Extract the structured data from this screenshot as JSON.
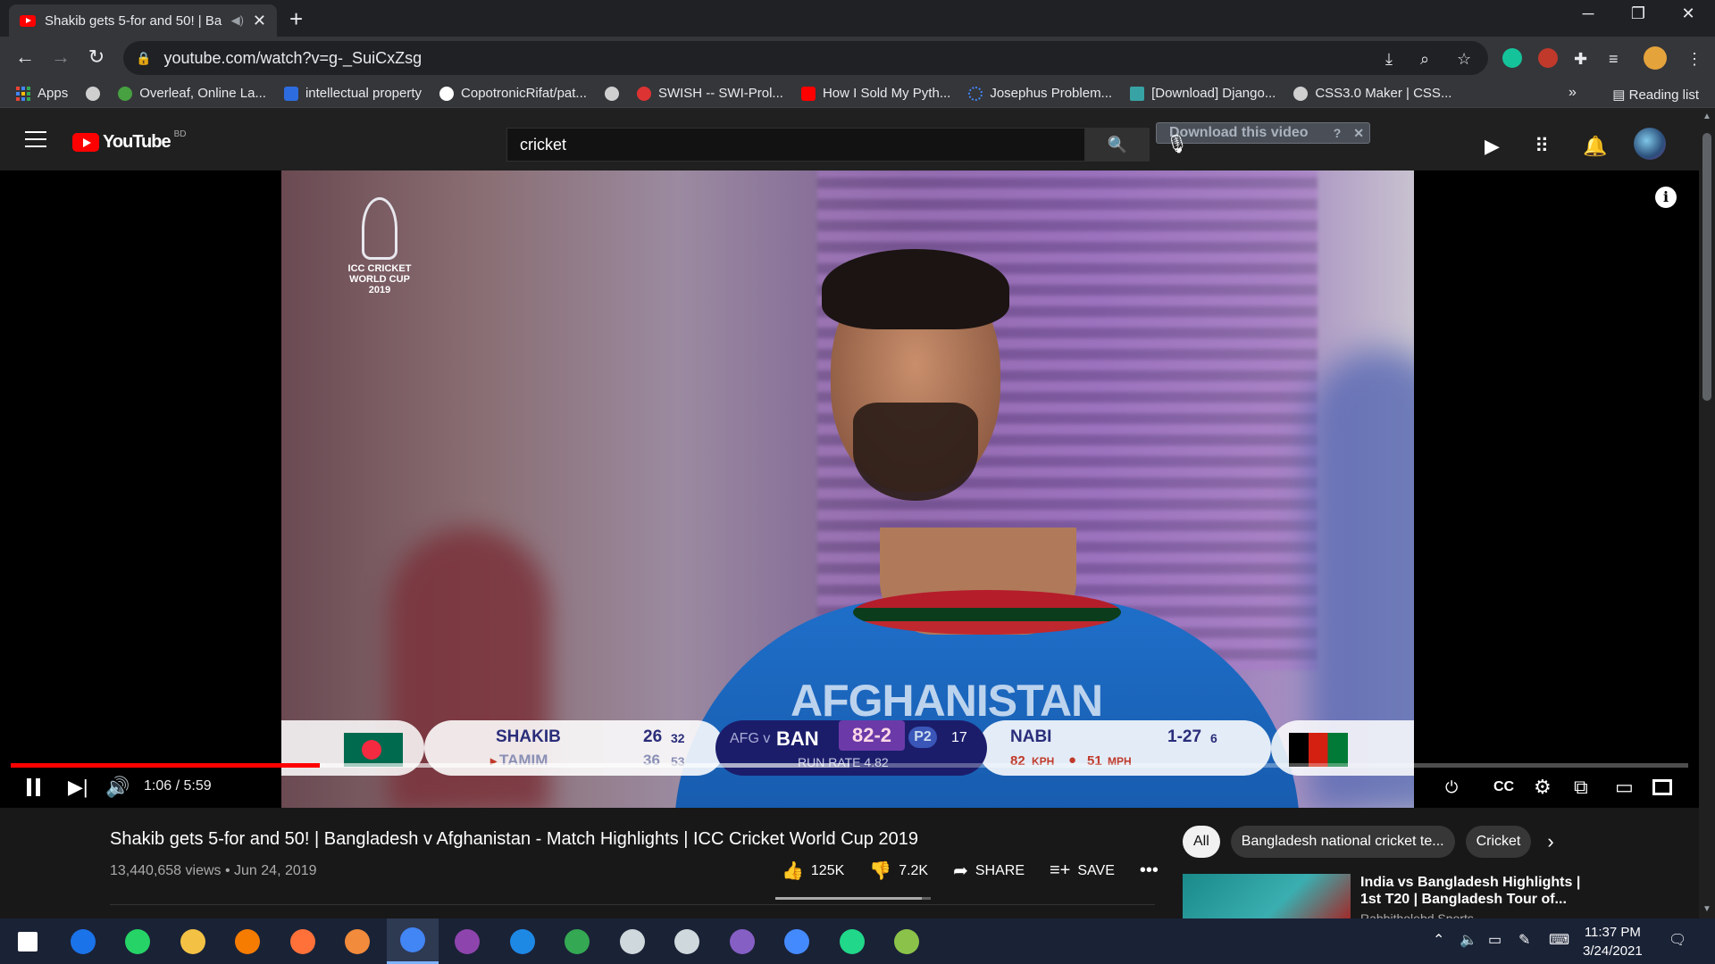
{
  "browser": {
    "tab": {
      "title": "Shakib gets 5-for and 50! | Ba"
    },
    "url": "youtube.com/watch?v=g-_SuiCxZsg",
    "bookmarks": [
      {
        "label": "Apps",
        "color": "#ea4335"
      },
      {
        "label": "",
        "color": "#cfcfcf"
      },
      {
        "label": "Overleaf, Online La...",
        "color": "#47a141"
      },
      {
        "label": "intellectual property",
        "color": "#2d6cdf"
      },
      {
        "label": "CopotronicRifat/pat...",
        "color": "#ffffff"
      },
      {
        "label": "",
        "color": "#cfcfcf"
      },
      {
        "label": "SWISH -- SWI-Prol...",
        "color": "#d33"
      },
      {
        "label": "How I Sold My Pyth...",
        "color": "#ff0000"
      },
      {
        "label": "Josephus Problem...",
        "color": "#4285f4"
      },
      {
        "label": "[Download] Django...",
        "color": "#38a3a5"
      },
      {
        "label": "CSS3.0 Maker | CSS...",
        "color": "#cfcfcf"
      }
    ],
    "bookmarks_more": "»",
    "reading_list": "Reading list"
  },
  "youtube": {
    "logo_text": "YouTube",
    "country": "BD",
    "search_value": "cricket",
    "download_label": "Download this video",
    "download_help": "?"
  },
  "video": {
    "cwc_logo": "ICC CRICKET WORLD CUP 2019",
    "jersey_text": "AFGHANISTAN",
    "scoreboard": {
      "batter1_name": "SHAKIB",
      "batter1_runs": "26",
      "batter1_balls": "32",
      "batter2_name": "TAMIM",
      "batter2_runs": "36",
      "batter2_balls": "53",
      "teams_afg": "AFG v",
      "teams_ban": "BAN",
      "score": "82-2",
      "powerplay": "P2",
      "overs": "17",
      "run_rate": "RUN RATE 4.82",
      "bowler_name": "NABI",
      "bowler_figures": "1-27",
      "bowler_overs": "6",
      "speed_kph": "82",
      "kph_unit": "KPH",
      "speed_mph": "51",
      "mph_unit": "MPH"
    },
    "time": "1:06 / 5:59",
    "played_fraction": 0.184,
    "loaded_fraction": 0.5
  },
  "details": {
    "title": "Shakib gets 5-for and 50! | Bangladesh v Afghanistan - Match Highlights | ICC Cricket World Cup 2019",
    "meta": "13,440,658 views • Jun 24, 2019",
    "likes": "125K",
    "dislikes": "7.2K",
    "share_label": "SHARE",
    "save_label": "SAVE",
    "like_ratio": 0.94
  },
  "chips": [
    "All",
    "Bangladesh national cricket te...",
    "Cricket"
  ],
  "recommendation": {
    "title": "India vs Bangladesh Highlights | 1st T20 | Bangladesh Tour of...",
    "channel": "Rabbitholebd Sports"
  },
  "taskbar": {
    "time": "11:37 PM",
    "date": "3/24/2021",
    "apps": [
      {
        "name": "start",
        "color": "#ffffff"
      },
      {
        "name": "anydesk",
        "color": "#1a73e8"
      },
      {
        "name": "whatsapp",
        "color": "#25d366"
      },
      {
        "name": "explorer",
        "color": "#f3c245"
      },
      {
        "name": "avast",
        "color": "#f57c00"
      },
      {
        "name": "firefox",
        "color": "#ff7139"
      },
      {
        "name": "sublime",
        "color": "#f28b3b"
      },
      {
        "name": "chrome",
        "color": "#4285f4"
      },
      {
        "name": "github",
        "color": "#8e44ad"
      },
      {
        "name": "vscode",
        "color": "#1e88e5"
      },
      {
        "name": "maps",
        "color": "#34a853"
      },
      {
        "name": "network",
        "color": "#cfd8dc"
      },
      {
        "name": "satellite",
        "color": "#cfd8dc"
      },
      {
        "name": "visualstudio",
        "color": "#865fc5"
      },
      {
        "name": "messenger",
        "color": "#448aff"
      },
      {
        "name": "pycharm",
        "color": "#21d789"
      },
      {
        "name": "excel",
        "color": "#8bc34a"
      }
    ]
  }
}
